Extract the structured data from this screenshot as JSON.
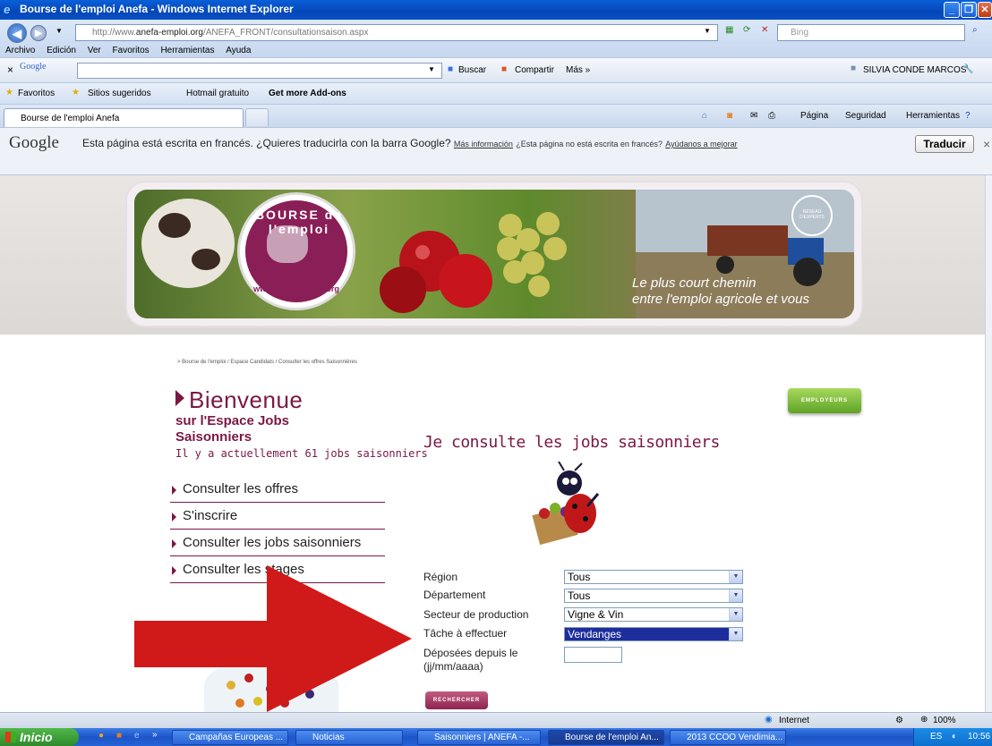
{
  "window": {
    "title": "Bourse de l'emploi Anefa - Windows Internet Explorer"
  },
  "address": {
    "url_prefix": "http://www.",
    "url_host": "anefa-emploi.org",
    "url_path": "/ANEFA_FRONT/consultationsaison.aspx",
    "search_placeholder": "Bing"
  },
  "menu": [
    "Archivo",
    "Edición",
    "Ver",
    "Favoritos",
    "Herramientas",
    "Ayuda"
  ],
  "google_toolbar": {
    "logo": "Google",
    "buscar": "Buscar",
    "compartir": "Compartir",
    "mas": "Más »",
    "user": "SILVIA CONDE MARCOS"
  },
  "favorites": {
    "label": "Favoritos",
    "items": [
      "Sitios sugeridos",
      "Hotmail gratuito",
      "Get more Add-ons"
    ]
  },
  "tab": {
    "title": "Bourse de l'emploi Anefa"
  },
  "tab_tools": {
    "pagina": "Página",
    "seguridad": "Seguridad",
    "herramientas": "Herramientas"
  },
  "translate": {
    "logo": "Google",
    "message": "Esta página está escrita en francés. ¿Quieres traducirla con la barra Google?",
    "more_info": "Más información",
    "not_french": "¿Esta página no está escrita en francés?",
    "help": "Ayúdanos a mejorar",
    "button": "Traducir"
  },
  "banner": {
    "logo_text": "BOURSE de l'emploi",
    "logo_url": "www.anefa-emploi.org",
    "badge": "RÉSEAU D'EXPERTS",
    "slogan_1": "Le plus court chemin",
    "slogan_2": "entre l'emploi agricole et vous"
  },
  "page": {
    "breadcrumb": "> Bourse de l'emploi / Espace Candidats / Consulter les offres Saisonnières",
    "welcome": "Bienvenue",
    "subtitle_1": "sur l'Espace Jobs",
    "subtitle_2": "Saisonniers",
    "count_text": "Il y a actuellement 61 jobs saisonniers",
    "employeurs": "EMPLOYEURS",
    "heading": "Je consulte les jobs saisonniers",
    "menu": [
      "Consulter les offres",
      "S'inscrire",
      "Consulter les jobs saisonniers",
      "Consulter les stages"
    ]
  },
  "form": {
    "region_label": "Région",
    "region_value": "Tous",
    "departement_label": "Département",
    "departement_value": "Tous",
    "secteur_label": "Secteur de production",
    "secteur_value": "Vigne & Vin",
    "tache_label": "Tâche à effectuer",
    "tache_value": "Vendanges",
    "date_label_1": "Déposées depuis le",
    "date_label_2": "(jj/mm/aaaa)",
    "submit": "RECHERCHER"
  },
  "status": {
    "zone": "Internet",
    "zoom": "100%"
  },
  "taskbar": {
    "start": "Inicio",
    "items": [
      "Campañas Europeas ...",
      "Noticias",
      "Saisonniers | ANEFA -...",
      "Bourse de l'emploi An...",
      "2013 CCOO Vendimia..."
    ],
    "lang": "ES",
    "time": "10:56"
  },
  "colors": {
    "brand": "#7a1845",
    "arrow": "#d01a1a",
    "employeurs": "#6fb02e"
  }
}
